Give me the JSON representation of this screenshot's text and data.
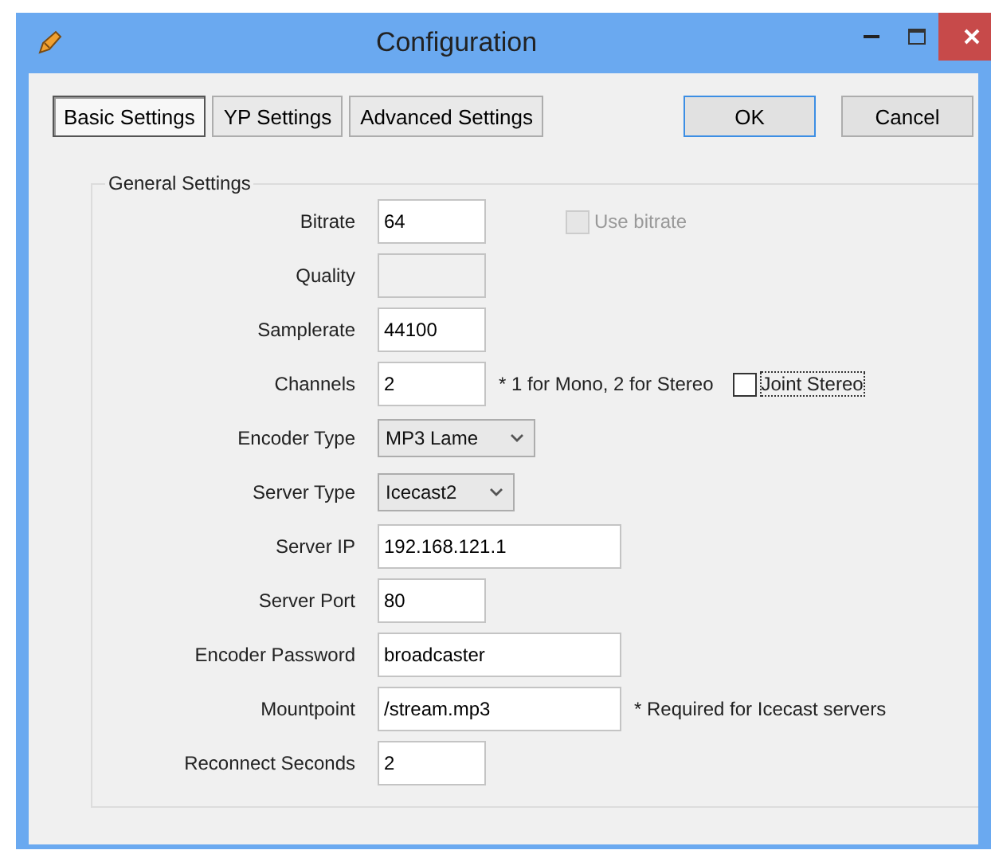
{
  "window": {
    "title": "Configuration"
  },
  "tabs": [
    {
      "label": "Basic Settings",
      "selected": true
    },
    {
      "label": "YP Settings",
      "selected": false
    },
    {
      "label": "Advanced Settings",
      "selected": false
    }
  ],
  "buttons": [
    {
      "label": "OK",
      "default": true
    },
    {
      "label": "Cancel",
      "default": false
    }
  ],
  "group": {
    "title": "General Settings",
    "rows": [
      {
        "label": "Bitrate",
        "kind": "short",
        "value": "64",
        "disabled": false,
        "extras": [
          {
            "kind": "checkbox",
            "label": "Use bitrate",
            "checked": false,
            "disabled": true,
            "focused": false
          }
        ]
      },
      {
        "label": "Quality",
        "kind": "short",
        "disabled": true
      },
      {
        "label": "Samplerate",
        "kind": "short",
        "value": "44100",
        "disabled": false
      },
      {
        "label": "Channels",
        "kind": "short",
        "value": "2",
        "disabled": false,
        "extras": [
          {
            "kind": "note",
            "label": "* 1 for Mono, 2 for Stereo"
          },
          {
            "kind": "checkbox",
            "label": "Joint Stereo",
            "checked": false,
            "disabled": false,
            "focused": true
          }
        ]
      },
      {
        "label": "Encoder Type",
        "kind": "select",
        "value": "MP3 Lame",
        "disabled": false
      },
      {
        "label": "Server Type",
        "kind": "select",
        "value": "Icecast2",
        "disabled": false
      },
      {
        "label": "Server IP",
        "kind": "long",
        "value": "192.168.121.1",
        "disabled": false
      },
      {
        "label": "Server Port",
        "kind": "short",
        "value": "80",
        "disabled": false
      },
      {
        "label": "Encoder Password",
        "kind": "long",
        "value": "broadcaster",
        "disabled": false
      },
      {
        "label": "Mountpoint",
        "kind": "long",
        "value": "/stream.mp3",
        "disabled": false,
        "extras": [
          {
            "kind": "note",
            "label": "* Required for Icecast servers"
          }
        ]
      },
      {
        "label": "Reconnect Seconds",
        "kind": "short",
        "value": "2",
        "disabled": false
      }
    ]
  }
}
